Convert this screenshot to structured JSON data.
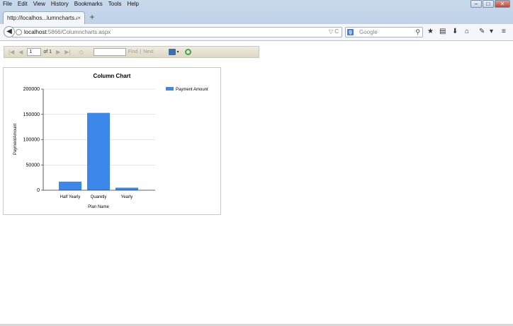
{
  "menu": [
    "File",
    "Edit",
    "View",
    "History",
    "Bookmarks",
    "Tools",
    "Help"
  ],
  "window_controls": {
    "minimize": "–",
    "maximize": "□",
    "close": "✕"
  },
  "tab": {
    "title": "http://localhos...lumncharts.aspx",
    "close": "×",
    "new": "+"
  },
  "address": {
    "host": "localhost",
    "rest": ":5866/Columncharts.aspx",
    "icons": "▽ C"
  },
  "search": {
    "engine": "g",
    "placeholder": "Google",
    "go": "⚲"
  },
  "toolbar_icons": [
    "★",
    "▤",
    "⬇",
    "⌂",
    "✎",
    "▾",
    "≡"
  ],
  "report_toolbar": {
    "first": "|◀",
    "prev": "◀",
    "page": "1",
    "of": "of 1",
    "next": "▶",
    "last": "▶|",
    "back": "◇",
    "find": "Find",
    "separator": "|",
    "find_next": "Next",
    "export_arrow": "▾"
  },
  "chart_data": {
    "type": "bar",
    "title": "Column Chart",
    "xlabel": "Plan Name",
    "ylabel": "PaymentAmount",
    "categories": [
      "Half Yearly",
      "Quaretly",
      "Yearly"
    ],
    "series": [
      {
        "name": "Payment Amount",
        "values": [
          17000,
          153000,
          5000
        ],
        "color": "#3b87ea"
      }
    ],
    "ylim": [
      0,
      200000
    ],
    "yticks": [
      0,
      50000,
      100000,
      150000,
      200000
    ],
    "grid": true,
    "legend": "top-right"
  }
}
